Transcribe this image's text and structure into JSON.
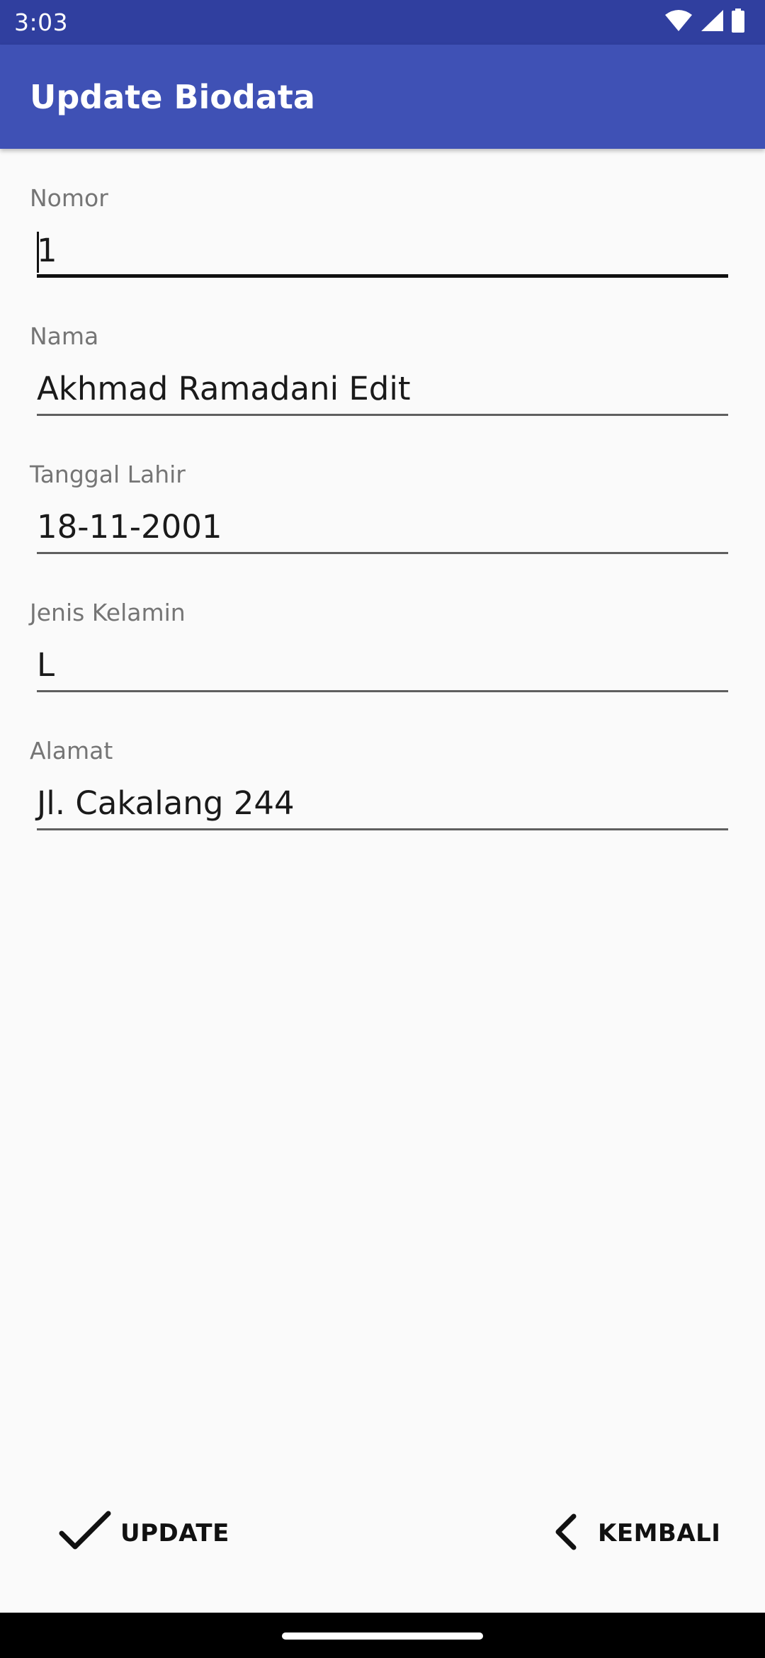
{
  "status_bar": {
    "time": "3:03",
    "icons": [
      "wifi-icon",
      "signal-icon",
      "battery-icon"
    ]
  },
  "app_bar": {
    "title": "Update Biodata"
  },
  "form": {
    "fields": [
      {
        "label": "Nomor",
        "value": "1",
        "focused": true
      },
      {
        "label": "Nama",
        "value": "Akhmad Ramadani Edit",
        "focused": false
      },
      {
        "label": "Tanggal Lahir",
        "value": "18-11-2001",
        "focused": false
      },
      {
        "label": "Jenis Kelamin",
        "value": "L",
        "focused": false
      },
      {
        "label": "Alamat",
        "value": "Jl. Cakalang 244",
        "focused": false
      }
    ]
  },
  "actions": {
    "update_label": "UPDATE",
    "update_icon": "check-icon",
    "kembali_label": "KEMBALI",
    "kembali_icon": "chevron-left-icon"
  },
  "colors": {
    "status_bar": "#303f9f",
    "app_bar": "#3f51b5",
    "background": "#fafafa"
  }
}
